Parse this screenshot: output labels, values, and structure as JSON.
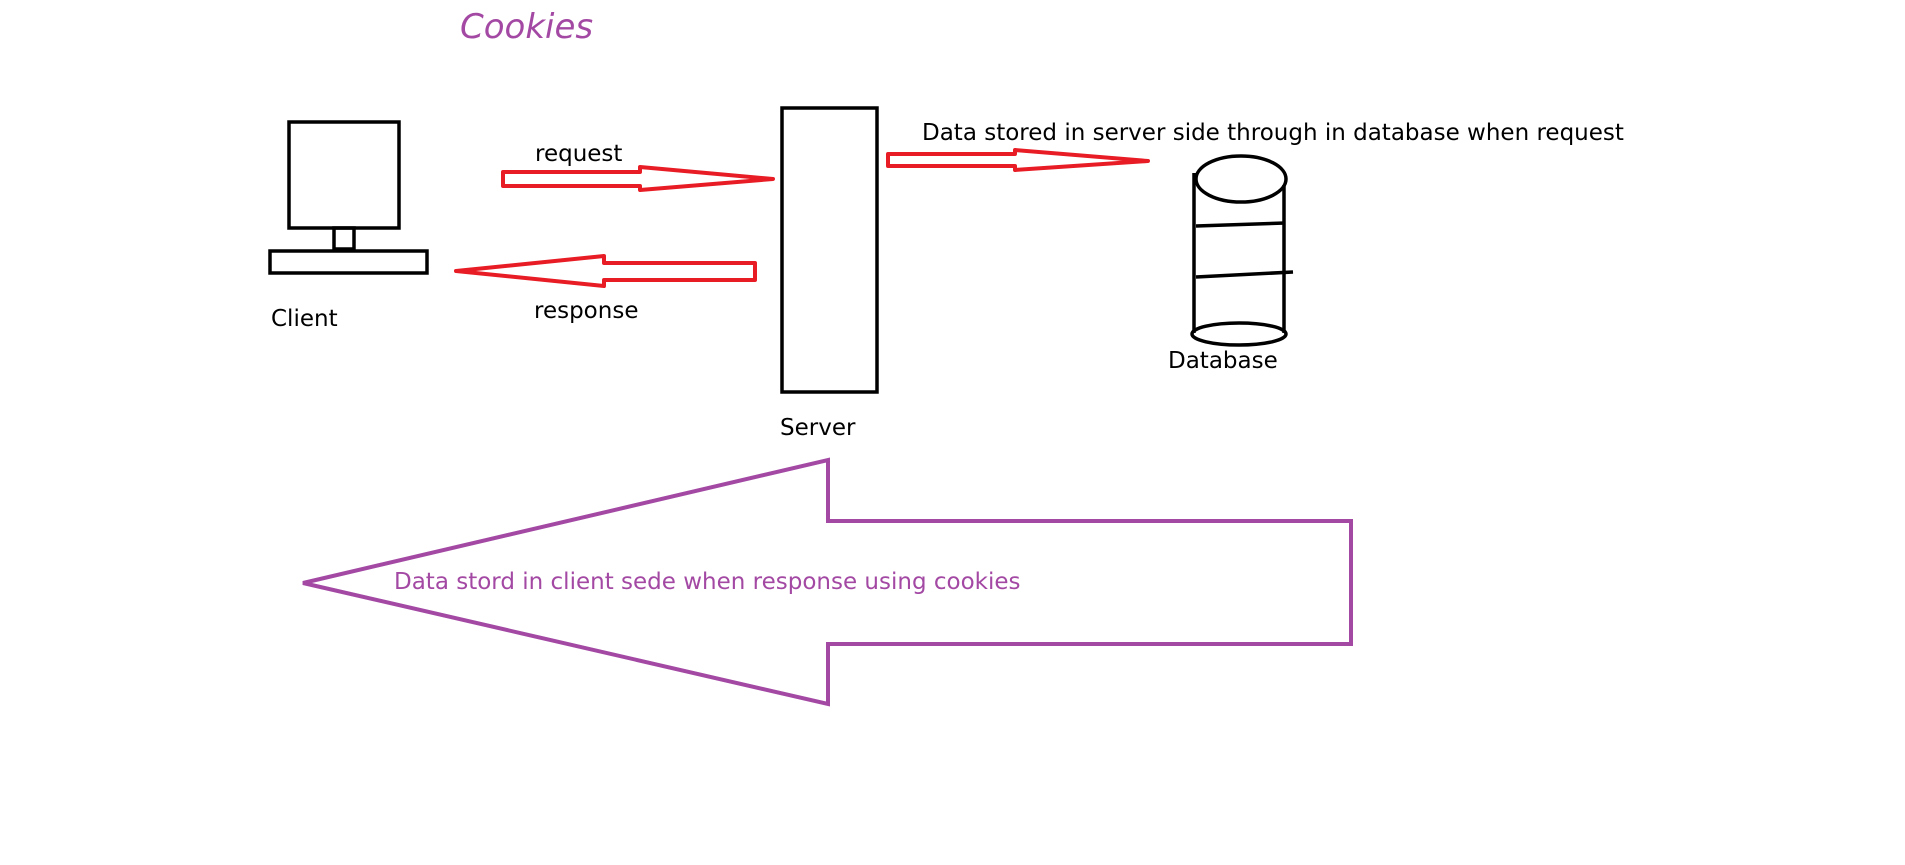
{
  "title": "Cookies",
  "labels": {
    "client": "Client",
    "server": "Server",
    "database": "Database",
    "request": "request",
    "response": "response",
    "server_side_note": "Data stored in server side through in database when request",
    "client_side_note": "Data stord in client sede when response using cookies"
  },
  "colors": {
    "title": "#a349a4",
    "arrow_red": "#e81c24",
    "outline": "#000000",
    "big_arrow": "#a349a4",
    "text": "#000000"
  }
}
